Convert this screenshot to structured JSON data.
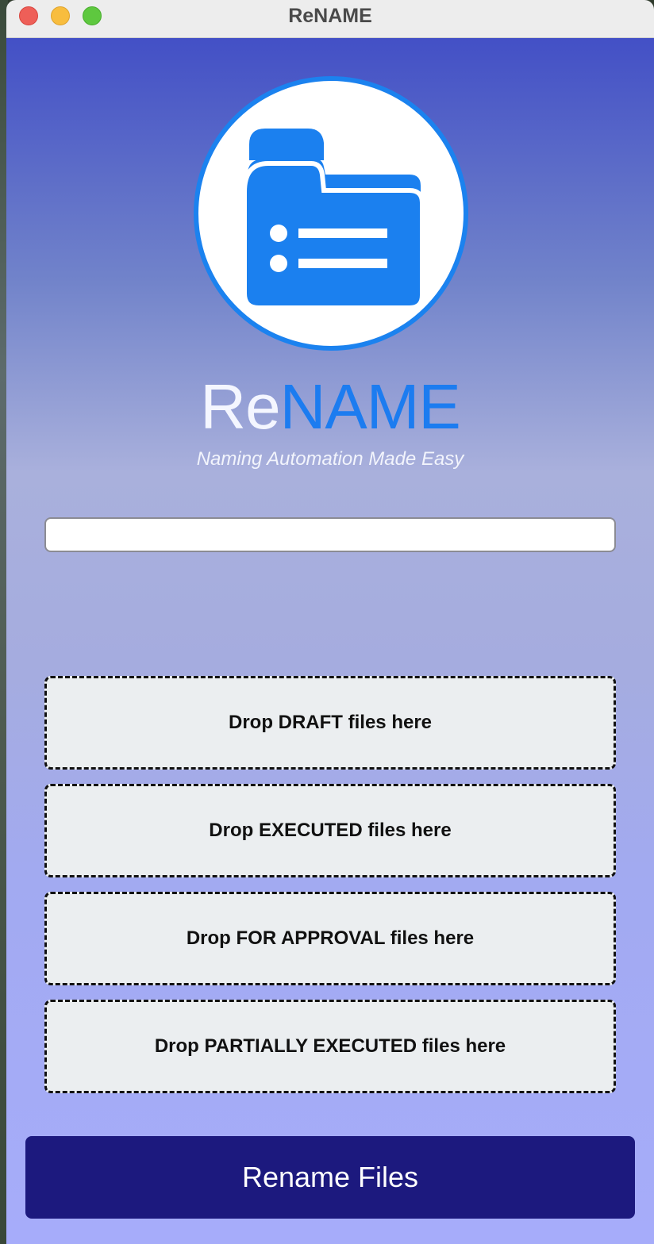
{
  "window": {
    "title": "ReNAME",
    "controls": [
      "close",
      "minimize",
      "zoom"
    ]
  },
  "logo": {
    "icon": "folder-list-icon",
    "name_part1": "Re",
    "name_part2": "NAME",
    "tagline": "Naming Automation Made Easy",
    "colors": {
      "accent": "#1c7cf0",
      "circle_border": "#1b82ef"
    }
  },
  "input": {
    "value": "",
    "placeholder": ""
  },
  "dropzones": [
    {
      "label": "Drop DRAFT files here"
    },
    {
      "label": "Drop EXECUTED files here"
    },
    {
      "label": "Drop FOR APPROVAL files here"
    },
    {
      "label": "Drop PARTIALLY EXECUTED files here"
    }
  ],
  "actions": {
    "rename_label": "Rename Files",
    "button_color": "#1c197e"
  }
}
